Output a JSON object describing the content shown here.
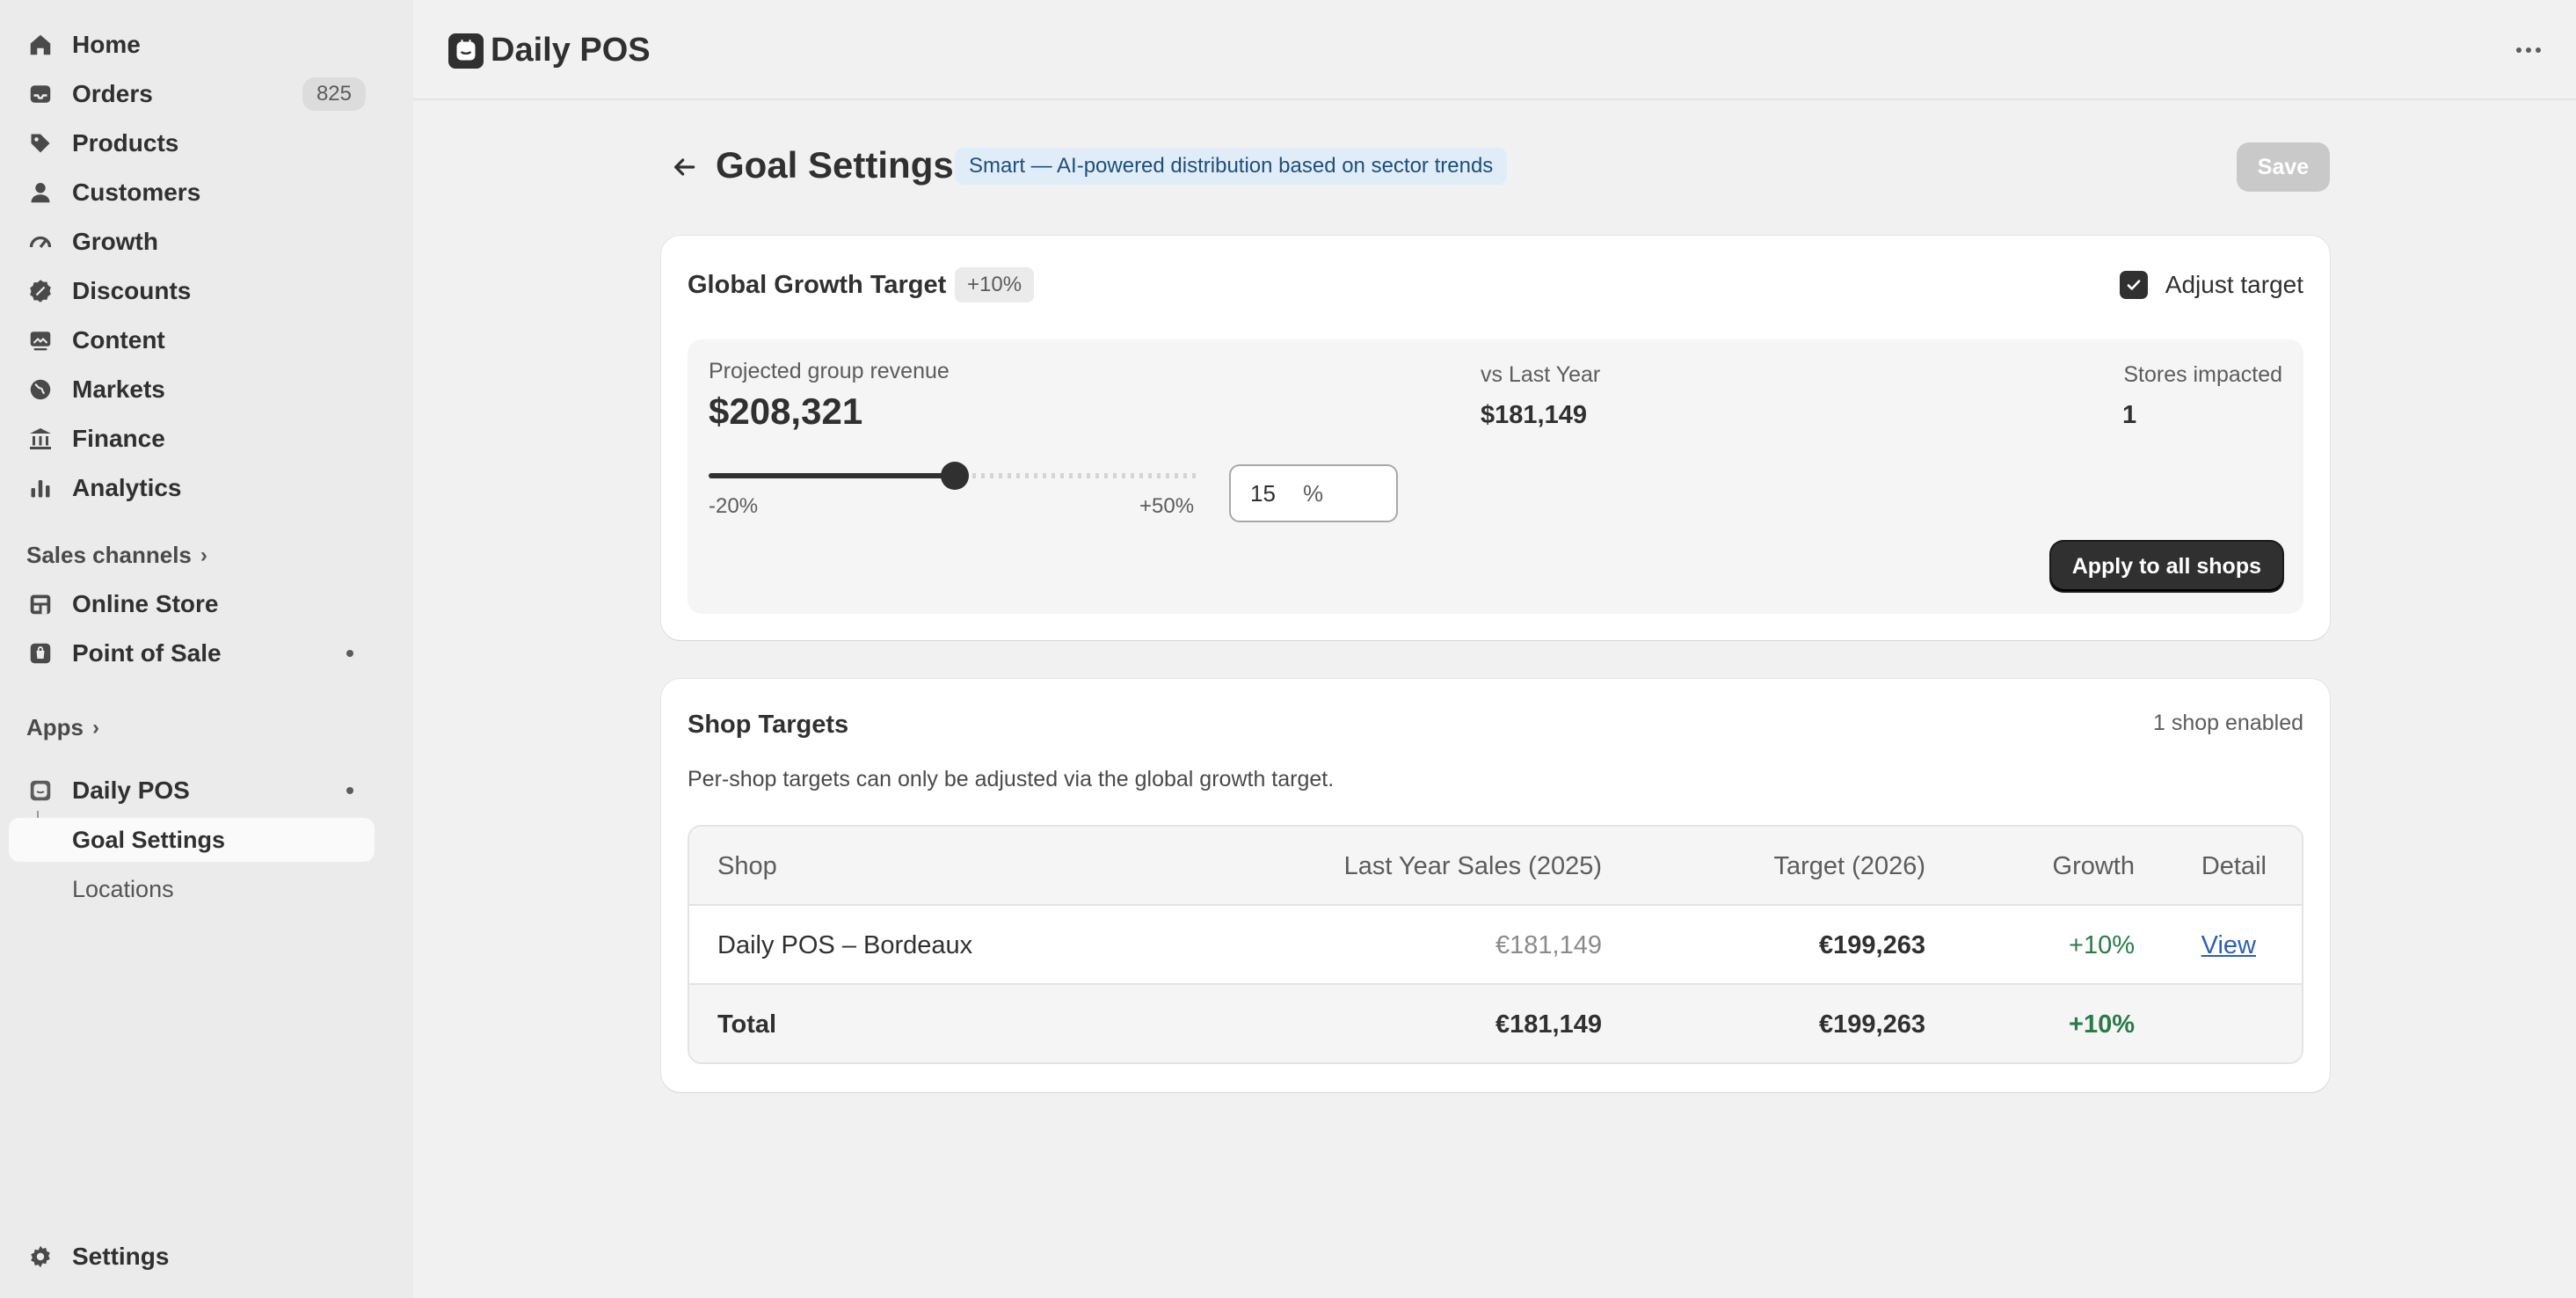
{
  "sidebar": {
    "items": [
      {
        "label": "Home",
        "icon": "home-icon"
      },
      {
        "label": "Orders",
        "icon": "inbox-icon",
        "badge": "825"
      },
      {
        "label": "Products",
        "icon": "tag-icon"
      },
      {
        "label": "Customers",
        "icon": "person-icon"
      },
      {
        "label": "Growth",
        "icon": "gauge-icon"
      },
      {
        "label": "Discounts",
        "icon": "discount-icon"
      },
      {
        "label": "Content",
        "icon": "image-icon"
      },
      {
        "label": "Markets",
        "icon": "globe-icon"
      },
      {
        "label": "Finance",
        "icon": "bank-icon"
      },
      {
        "label": "Analytics",
        "icon": "bar-chart-icon"
      }
    ],
    "sales_channels": {
      "label": "Sales channels",
      "items": [
        {
          "label": "Online Store",
          "icon": "store-icon"
        },
        {
          "label": "Point of Sale",
          "icon": "pos-bag-icon"
        }
      ]
    },
    "apps": {
      "label": "Apps",
      "app": {
        "label": "Daily POS",
        "icon": "daily-pos-icon"
      },
      "sub_items": [
        {
          "label": "Goal Settings",
          "active": true
        },
        {
          "label": "Locations",
          "active": false
        }
      ]
    },
    "settings": {
      "label": "Settings",
      "icon": "gear-icon"
    }
  },
  "topbar": {
    "app_title": "Daily POS"
  },
  "page": {
    "title": "Goal Settings",
    "mode_badge": "Smart — AI-powered distribution based on sector trends",
    "save_label": "Save"
  },
  "global_target": {
    "title": "Global Growth Target",
    "badge": "+10%",
    "adjust_label": "Adjust target",
    "adjust_checked": true,
    "projected_label": "Projected group revenue",
    "projected_value": "$208,321",
    "vs_label": "vs Last Year",
    "vs_value": "$181,149",
    "stores_label": "Stores impacted",
    "stores_value": "1",
    "slider": {
      "min_label": "-20%",
      "max_label": "+50%",
      "min": -20,
      "max": 50,
      "value": 15
    },
    "input_value": "15",
    "input_suffix": "%",
    "apply_label": "Apply to all shops"
  },
  "shop_targets": {
    "title": "Shop Targets",
    "enabled_text": "1 shop enabled",
    "description": "Per-shop targets can only be adjusted via the global growth target.",
    "columns": [
      "Shop",
      "Last Year Sales (2025)",
      "Target (2026)",
      "Growth",
      "Detail"
    ],
    "rows": [
      {
        "shop": "Daily POS – Bordeaux",
        "last_year": "€181,149",
        "target": "€199,263",
        "growth": "+10%",
        "detail": "View"
      }
    ],
    "total": {
      "label": "Total",
      "last_year": "€181,149",
      "target": "€199,263",
      "growth": "+10%"
    }
  },
  "colors": {
    "accent_dark": "#303030",
    "positive": "#2a7a4a",
    "link": "#2c5fb8",
    "badge_bg": "#e0edf9"
  }
}
